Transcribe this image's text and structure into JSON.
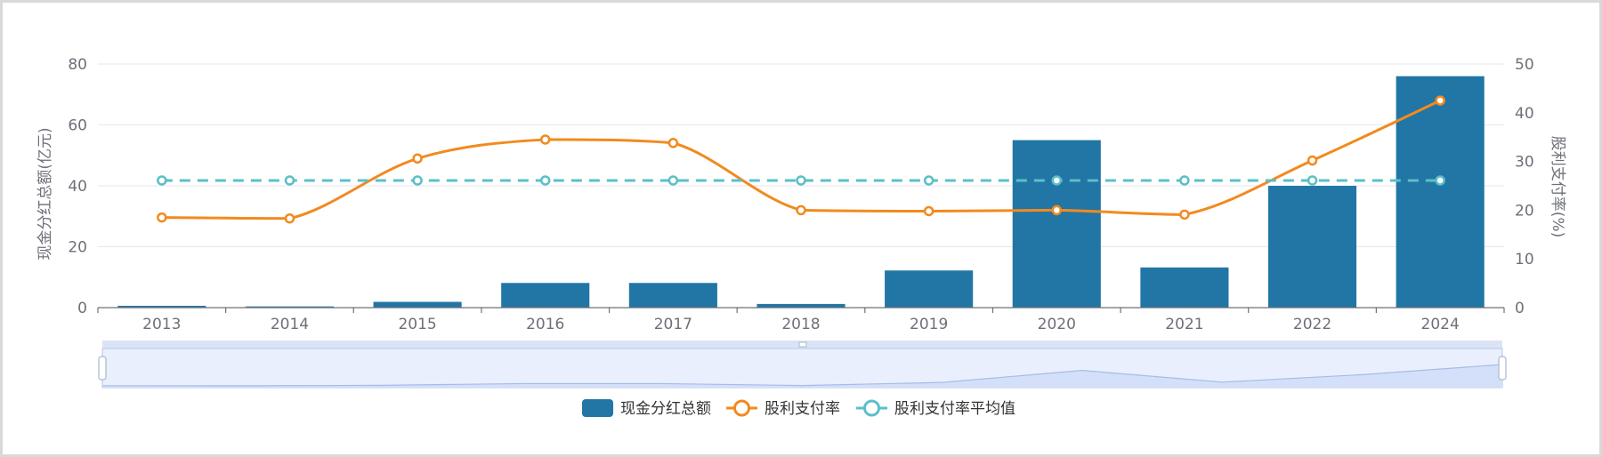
{
  "chart_data": {
    "type": "bar",
    "categories": [
      "2013",
      "2014",
      "2015",
      "2016",
      "2017",
      "2018",
      "2019",
      "2020",
      "2021",
      "2022",
      "2024"
    ],
    "series": [
      {
        "name": "现金分红总额",
        "type": "bar",
        "axis": "left",
        "values": [
          0.6,
          0.4,
          1.9,
          8.1,
          8.1,
          1.2,
          12.2,
          55.0,
          13.2,
          40.0,
          76.0
        ]
      },
      {
        "name": "股利支付率",
        "type": "line",
        "axis": "right",
        "smooth": true,
        "values": [
          18.5,
          18.3,
          30.6,
          34.5,
          33.8,
          20.0,
          19.8,
          20.0,
          19.1,
          30.2,
          42.5
        ]
      },
      {
        "name": "股利支付率平均值",
        "type": "line",
        "axis": "right",
        "dashed": true,
        "values": [
          26.1,
          26.1,
          26.1,
          26.1,
          26.1,
          26.1,
          26.1,
          26.1,
          26.1,
          26.1,
          26.1
        ]
      }
    ],
    "y_left": {
      "label": "现金分红总额(亿元)",
      "min": 0,
      "max": 80,
      "ticks": [
        0,
        20,
        40,
        60,
        80
      ]
    },
    "y_right": {
      "label": "股利支付率(%)",
      "min": 0,
      "max": 50,
      "ticks": [
        0,
        10,
        20,
        30,
        40,
        50
      ]
    },
    "grid": true,
    "legend": "bottom-center",
    "has_data_zoom": true,
    "colors": {
      "bar": "#2176a5",
      "line": "#f28a1e",
      "avg": "#5bbfc9",
      "grid": "#e3e7f0",
      "axis": "#6e7079",
      "zoom_fill": "#d4e0f9",
      "zoom_bg": "#e9effc",
      "zoom_border": "#b7c7ea",
      "zoom_line": "#a6bce6"
    }
  }
}
